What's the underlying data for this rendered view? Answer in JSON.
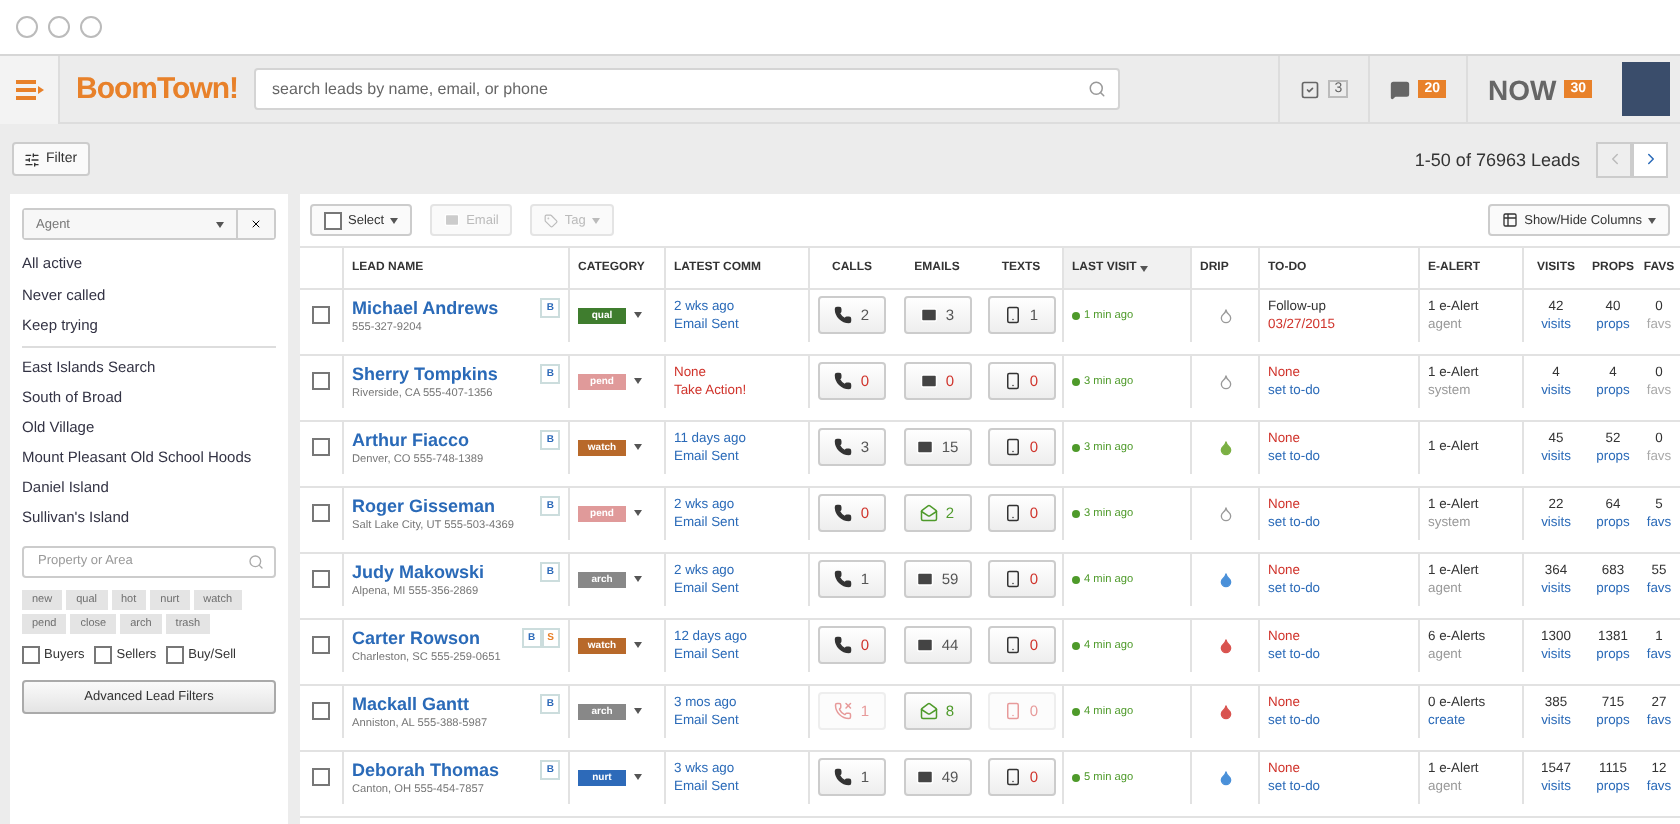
{
  "app": {
    "logo": "BoomTown!",
    "search": {
      "placeholder": "search leads by name, email, or phone"
    },
    "tasks": {
      "count": "3"
    },
    "messages": {
      "count": "20"
    },
    "now": {
      "label": "NOW",
      "count": "30"
    }
  },
  "toolbar": {
    "filter": "Filter",
    "pagination": "1-50 of 76963 Leads",
    "prev": {
      "disabled": true
    },
    "next": {
      "disabled": false
    }
  },
  "sidebar": {
    "agent": {
      "placeholder": "Agent"
    },
    "quick_filters": [
      "All active",
      "Never called",
      "Keep trying"
    ],
    "saved_searches": [
      "East Islands Search",
      "South of Broad",
      "Old Village",
      "Mount Pleasant Old School Hoods",
      "Daniel Island",
      "Sullivan's Island"
    ],
    "area": {
      "placeholder": "Property or Area"
    },
    "tags": [
      {
        "label": "new",
        "disabled": true
      },
      {
        "label": "qual",
        "disabled": true
      },
      {
        "label": "hot",
        "disabled": true
      },
      {
        "label": "nurt",
        "disabled": true
      },
      {
        "label": "watch",
        "disabled": true
      },
      {
        "label": "pend",
        "disabled": true
      },
      {
        "label": "close",
        "disabled": true
      },
      {
        "label": "arch",
        "disabled": true
      },
      {
        "label": "trash",
        "disabled": true
      }
    ],
    "types": [
      {
        "label": "Buyers",
        "checked": false
      },
      {
        "label": "Sellers",
        "checked": false
      },
      {
        "label": "Buy/Sell",
        "checked": false
      }
    ],
    "advanced": "Advanced Lead Filters"
  },
  "table": {
    "actions": {
      "select": "Select",
      "email": {
        "label": "Email",
        "disabled": true
      },
      "tag": {
        "label": "Tag",
        "disabled": true
      },
      "columns_button": "Show/Hide Columns"
    },
    "columns": [
      {
        "label": "LEAD NAME",
        "sorted": false
      },
      {
        "label": "CATEGORY",
        "sorted": false
      },
      {
        "label": "LATEST COMM",
        "sorted": false
      },
      {
        "label": "CALLS",
        "sorted": false
      },
      {
        "label": "EMAILS",
        "sorted": false
      },
      {
        "label": "TEXTS",
        "sorted": false
      },
      {
        "label": "LAST VISIT",
        "sorted": true
      },
      {
        "label": "DRIP",
        "sorted": false
      },
      {
        "label": "TO-DO",
        "sorted": false
      },
      {
        "label": "E-ALERT",
        "sorted": false
      },
      {
        "label": "VISITS",
        "sorted": false
      },
      {
        "label": "PROPS",
        "sorted": false
      },
      {
        "label": "FAVS",
        "sorted": false
      }
    ],
    "rows": [
      {
        "checked": false,
        "name": "Michael Andrews",
        "sub": "555-327-9204",
        "badges": [
          {
            "label": "B",
            "color": "#2d6ab9"
          }
        ],
        "category": {
          "label": "qual",
          "color": "#3f7d2e"
        },
        "comm": {
          "kind": "sent",
          "when": "2 wks ago",
          "what": "Email Sent"
        },
        "calls": {
          "count": "2",
          "kind": "normal"
        },
        "emails": {
          "count": "3",
          "kind": "normal"
        },
        "texts": {
          "count": "1",
          "kind": "normal"
        },
        "last_visit": "1 min ago",
        "drip": {
          "kind": "empty"
        },
        "todo": {
          "kind": "task",
          "title": "Follow-up",
          "sub": "03/27/2015"
        },
        "ealert": {
          "title": "1 e-Alert",
          "sub": "agent",
          "link": false
        },
        "visits": {
          "count": "42",
          "label": "visits",
          "active": true
        },
        "props": {
          "count": "40",
          "label": "props",
          "active": true
        },
        "favs": {
          "count": "0",
          "label": "favs",
          "active": false
        }
      },
      {
        "checked": false,
        "name": "Sherry Tompkins",
        "sub": "Riverside, CA  555-407-1356",
        "badges": [
          {
            "label": "B",
            "color": "#2d6ab9"
          }
        ],
        "category": {
          "label": "pend",
          "color": "#e09a9a"
        },
        "comm": {
          "kind": "none",
          "when": "None",
          "what": "Take Action!"
        },
        "calls": {
          "count": "0",
          "kind": "zero"
        },
        "emails": {
          "count": "0",
          "kind": "zero"
        },
        "texts": {
          "count": "0",
          "kind": "zero"
        },
        "last_visit": "3 min ago",
        "drip": {
          "kind": "empty"
        },
        "todo": {
          "kind": "none",
          "title": "None",
          "sub": "set to-do"
        },
        "ealert": {
          "title": "1 e-Alert",
          "sub": "system",
          "link": false
        },
        "visits": {
          "count": "4",
          "label": "visits",
          "active": true
        },
        "props": {
          "count": "4",
          "label": "props",
          "active": true
        },
        "favs": {
          "count": "0",
          "label": "favs",
          "active": false
        }
      },
      {
        "checked": false,
        "name": "Arthur Fiacco",
        "sub": "Denver, CO  555-748-1389",
        "badges": [
          {
            "label": "B",
            "color": "#2d6ab9"
          }
        ],
        "category": {
          "label": "watch",
          "color": "#b8692a"
        },
        "comm": {
          "kind": "sent",
          "when": "11 days ago",
          "what": "Email Sent"
        },
        "calls": {
          "count": "3",
          "kind": "normal"
        },
        "emails": {
          "count": "15",
          "kind": "normal"
        },
        "texts": {
          "count": "0",
          "kind": "zero"
        },
        "last_visit": "3 min ago",
        "drip": {
          "kind": "filled",
          "color": "#7bb043"
        },
        "todo": {
          "kind": "none",
          "title": "None",
          "sub": "set to-do"
        },
        "ealert": {
          "title": "1 e-Alert"
        },
        "visits": {
          "count": "45",
          "label": "visits",
          "active": true
        },
        "props": {
          "count": "52",
          "label": "props",
          "active": true
        },
        "favs": {
          "count": "0",
          "label": "favs",
          "active": false
        }
      },
      {
        "checked": false,
        "name": "Roger Gisseman",
        "sub": "Salt Lake City, UT  555-503-4369",
        "badges": [
          {
            "label": "B",
            "color": "#2d6ab9"
          }
        ],
        "category": {
          "label": "pend",
          "color": "#e09a9a"
        },
        "comm": {
          "kind": "sent",
          "when": "2 wks ago",
          "what": "Email Sent"
        },
        "calls": {
          "count": "0",
          "kind": "zero"
        },
        "emails": {
          "count": "2",
          "kind": "opened"
        },
        "texts": {
          "count": "0",
          "kind": "zero"
        },
        "last_visit": "3 min ago",
        "drip": {
          "kind": "empty"
        },
        "todo": {
          "kind": "none",
          "title": "None",
          "sub": "set to-do"
        },
        "ealert": {
          "title": "1 e-Alert",
          "sub": "system",
          "link": false
        },
        "visits": {
          "count": "22",
          "label": "visits",
          "active": true
        },
        "props": {
          "count": "64",
          "label": "props",
          "active": true
        },
        "favs": {
          "count": "5",
          "label": "favs",
          "active": true
        }
      },
      {
        "checked": false,
        "name": "Judy Makowski",
        "sub": "Alpena, MI  555-356-2869",
        "badges": [
          {
            "label": "B",
            "color": "#2d6ab9"
          }
        ],
        "category": {
          "label": "arch",
          "color": "#888888"
        },
        "comm": {
          "kind": "sent",
          "when": "2 wks ago",
          "what": "Email Sent"
        },
        "calls": {
          "count": "1",
          "kind": "normal"
        },
        "emails": {
          "count": "59",
          "kind": "normal"
        },
        "texts": {
          "count": "0",
          "kind": "zero"
        },
        "last_visit": "4 min ago",
        "drip": {
          "kind": "filled",
          "color": "#4a90d9"
        },
        "todo": {
          "kind": "none",
          "title": "None",
          "sub": "set to-do"
        },
        "ealert": {
          "title": "1 e-Alert",
          "sub": "agent",
          "link": false
        },
        "visits": {
          "count": "364",
          "label": "visits",
          "active": true
        },
        "props": {
          "count": "683",
          "label": "props",
          "active": true
        },
        "favs": {
          "count": "55",
          "label": "favs",
          "active": true
        }
      },
      {
        "checked": false,
        "name": "Carter Rowson",
        "sub": "Charleston, SC  555-259-0651",
        "badges": [
          {
            "label": "B",
            "color": "#2d6ab9"
          },
          {
            "label": "S",
            "color": "#e8812a"
          }
        ],
        "category": {
          "label": "watch",
          "color": "#b8692a"
        },
        "comm": {
          "kind": "sent",
          "when": "12 days ago",
          "what": "Email Sent"
        },
        "calls": {
          "count": "0",
          "kind": "zero"
        },
        "emails": {
          "count": "44",
          "kind": "normal"
        },
        "texts": {
          "count": "0",
          "kind": "zero"
        },
        "last_visit": "4 min ago",
        "drip": {
          "kind": "filled",
          "color": "#d9534f"
        },
        "todo": {
          "kind": "none",
          "title": "None",
          "sub": "set to-do"
        },
        "ealert": {
          "title": "6 e-Alerts",
          "sub": "agent",
          "link": false
        },
        "visits": {
          "count": "1300",
          "label": "visits",
          "active": true
        },
        "props": {
          "count": "1381",
          "label": "props",
          "active": true
        },
        "favs": {
          "count": "1",
          "label": "favs",
          "active": true
        }
      },
      {
        "checked": false,
        "name": "Mackall Gantt",
        "sub": "Anniston, AL  555-388-5987",
        "badges": [
          {
            "label": "B",
            "color": "#2d6ab9"
          }
        ],
        "category": {
          "label": "arch",
          "color": "#888888"
        },
        "comm": {
          "kind": "sent",
          "when": "3 mos ago",
          "what": "Email Sent"
        },
        "calls": {
          "count": "1",
          "kind": "failed"
        },
        "emails": {
          "count": "8",
          "kind": "opened"
        },
        "texts": {
          "count": "0",
          "kind": "failed"
        },
        "last_visit": "4 min ago",
        "drip": {
          "kind": "filled",
          "color": "#d9534f"
        },
        "todo": {
          "kind": "none",
          "title": "None",
          "sub": "set to-do"
        },
        "ealert": {
          "title": "0 e-Alerts",
          "sub": "create",
          "link": true
        },
        "visits": {
          "count": "385",
          "label": "visits",
          "active": true
        },
        "props": {
          "count": "715",
          "label": "props",
          "active": true
        },
        "favs": {
          "count": "27",
          "label": "favs",
          "active": true
        }
      },
      {
        "checked": false,
        "name": "Deborah Thomas",
        "sub": "Canton, OH  555-454-7857",
        "badges": [
          {
            "label": "B",
            "color": "#2d6ab9"
          }
        ],
        "category": {
          "label": "nurt",
          "color": "#2d6ab9"
        },
        "comm": {
          "kind": "sent",
          "when": "3 wks ago",
          "what": "Email Sent"
        },
        "calls": {
          "count": "1",
          "kind": "normal"
        },
        "emails": {
          "count": "49",
          "kind": "normal"
        },
        "texts": {
          "count": "0",
          "kind": "zero"
        },
        "last_visit": "5 min ago",
        "drip": {
          "kind": "filled",
          "color": "#4a90d9"
        },
        "todo": {
          "kind": "none",
          "title": "None",
          "sub": "set to-do"
        },
        "ealert": {
          "title": "1 e-Alert",
          "sub": "agent",
          "link": false
        },
        "visits": {
          "count": "1547",
          "label": "visits",
          "active": true
        },
        "props": {
          "count": "1115",
          "label": "props",
          "active": true
        },
        "favs": {
          "count": "12",
          "label": "favs",
          "active": true
        }
      }
    ]
  }
}
